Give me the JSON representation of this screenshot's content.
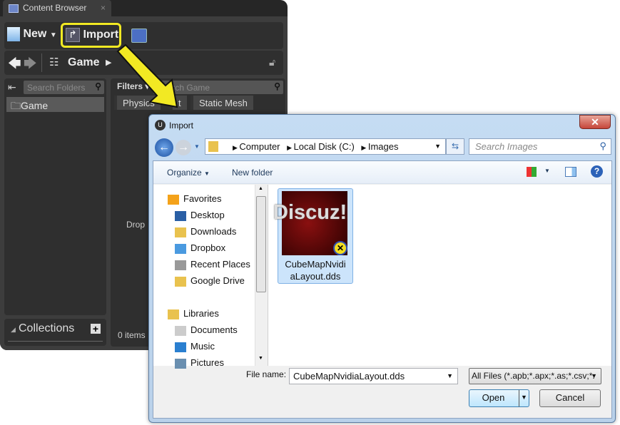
{
  "ue": {
    "tab_title": "Content Browser",
    "new_label": "New",
    "import_label": "Import",
    "path": "Game",
    "search_folders_placeholder": "Search Folders",
    "folder": "Game",
    "filters_label": "Filters",
    "search_game_placeholder": "Search Game",
    "filter_chips": [
      "Physics",
      "t",
      "Static Mesh"
    ],
    "drop_text": "Drop",
    "collections_label": "Collections",
    "items_count": "0 items",
    "highlight_color": "#f2e923"
  },
  "dialog": {
    "title": "Import",
    "breadcrumb": [
      "Computer",
      "Local Disk (C:)",
      "Images"
    ],
    "search_placeholder": "Search Images",
    "organize_label": "Organize",
    "new_folder_label": "New folder",
    "nav": [
      {
        "label": "Favorites",
        "icon": "star-icon"
      },
      {
        "label": "Desktop",
        "icon": "desktop-icon"
      },
      {
        "label": "Downloads",
        "icon": "downloads-icon"
      },
      {
        "label": "Dropbox",
        "icon": "dropbox-icon"
      },
      {
        "label": "Recent Places",
        "icon": "recent-places-icon"
      },
      {
        "label": "Google Drive",
        "icon": "google-drive-icon"
      },
      {
        "label": "Libraries",
        "icon": "libraries-icon"
      },
      {
        "label": "Documents",
        "icon": "documents-icon"
      },
      {
        "label": "Music",
        "icon": "music-icon"
      },
      {
        "label": "Pictures",
        "icon": "pictures-icon"
      }
    ],
    "file": {
      "name_line1": "CubeMapNvidi",
      "name_line2": "aLayout.dds",
      "thumb_text": "Discuz!"
    },
    "file_name_label": "File name:",
    "file_name_value": "CubeMapNvidiaLayout.dds",
    "file_type": "All Files (*.apb;*.apx;*.as;*.csv;*.",
    "open_label": "Open",
    "cancel_label": "Cancel"
  }
}
